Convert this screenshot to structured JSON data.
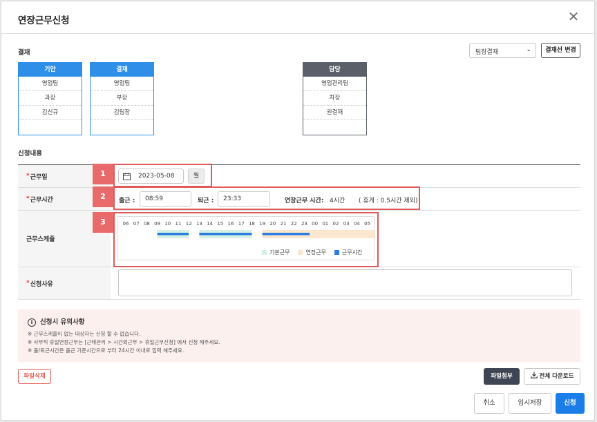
{
  "dialog": {
    "title": "연장근무신청",
    "close_symbol": "✕"
  },
  "approval": {
    "section_label": "결재",
    "line_select": {
      "selected": "팀장결재",
      "arrow": "⌄"
    },
    "change_button": "결재선 변경",
    "boxes": [
      {
        "header": "기안",
        "rows": [
          "영업팀",
          "과장",
          "김신규"
        ]
      },
      {
        "header": "결재",
        "rows": [
          "영업팀",
          "부장",
          "김팀장"
        ]
      },
      {
        "header": "담당",
        "rows": [
          "영업관리팀",
          "차장",
          "권결재"
        ]
      }
    ],
    "colors": {
      "blue_header": "#2e8ee8",
      "gray_header": "#5b5f6a"
    }
  },
  "request": {
    "section_label": "신청내용",
    "required_mark": "*",
    "work_date": {
      "label": "근무일",
      "value": "2023-05-08",
      "weekday": "월",
      "badge": "1"
    },
    "work_time": {
      "label": "근무시간",
      "badge": "2",
      "start_label": "출근 :",
      "start_value": "08:59",
      "end_label": "퇴근 :",
      "end_value": "23:33",
      "overtime_label": "연장근무 시간:",
      "overtime_value": "4시간",
      "break_note": "( 휴게 : 0.5시간 제외)"
    },
    "schedule": {
      "label": "근무스케줄",
      "badge": "3",
      "hours": [
        "06",
        "07",
        "08",
        "09",
        "10",
        "11",
        "12",
        "13",
        "14",
        "15",
        "16",
        "17",
        "18",
        "19",
        "20",
        "21",
        "22",
        "23",
        "00",
        "01",
        "02",
        "03",
        "04",
        "05",
        "06"
      ],
      "legend": [
        {
          "label": "기본근무",
          "color": "#d4f1e4"
        },
        {
          "label": "연장근무",
          "color": "#fbe7cf"
        },
        {
          "label": "근무시간",
          "color": "#2b7de0"
        }
      ]
    },
    "reason": {
      "label": "신청사유",
      "value": ""
    }
  },
  "chart_data": {
    "type": "gantt",
    "x_axis_hours": [
      "06",
      "07",
      "08",
      "09",
      "10",
      "11",
      "12",
      "13",
      "14",
      "15",
      "16",
      "17",
      "18",
      "19",
      "20",
      "21",
      "22",
      "23",
      "00",
      "01",
      "02",
      "03",
      "04",
      "05",
      "06"
    ],
    "series": [
      {
        "name": "기본근무",
        "segments": [
          [
            9,
            12
          ],
          [
            13,
            18
          ]
        ]
      },
      {
        "name": "연장근무",
        "segments": [
          [
            19,
            30
          ]
        ]
      },
      {
        "name": "근무시간",
        "segments": [
          [
            9,
            12
          ],
          [
            13,
            18
          ],
          [
            19,
            23.5
          ]
        ]
      }
    ]
  },
  "notice": {
    "title": "신청시 유의사항",
    "info_icon": "i",
    "lines": [
      "※ 근무스케줄이 없는 대상자는 신청 할 수 없습니다.",
      "※ 사무직 휴일연장근무는 [근태관리 > 시간외근무 > 휴일근무신청] 에서 신청 해주세요.",
      "※ 출/퇴근시간은 출근 기준시간으로 부터 24시간 이내로 입력 해주세요."
    ]
  },
  "files": {
    "delete_button": "파일삭제",
    "attach_button": "파일첨부",
    "download_all_button": "전체 다운로드"
  },
  "footer": {
    "cancel": "취소",
    "temp_save": "임시저장",
    "submit": "신청"
  }
}
